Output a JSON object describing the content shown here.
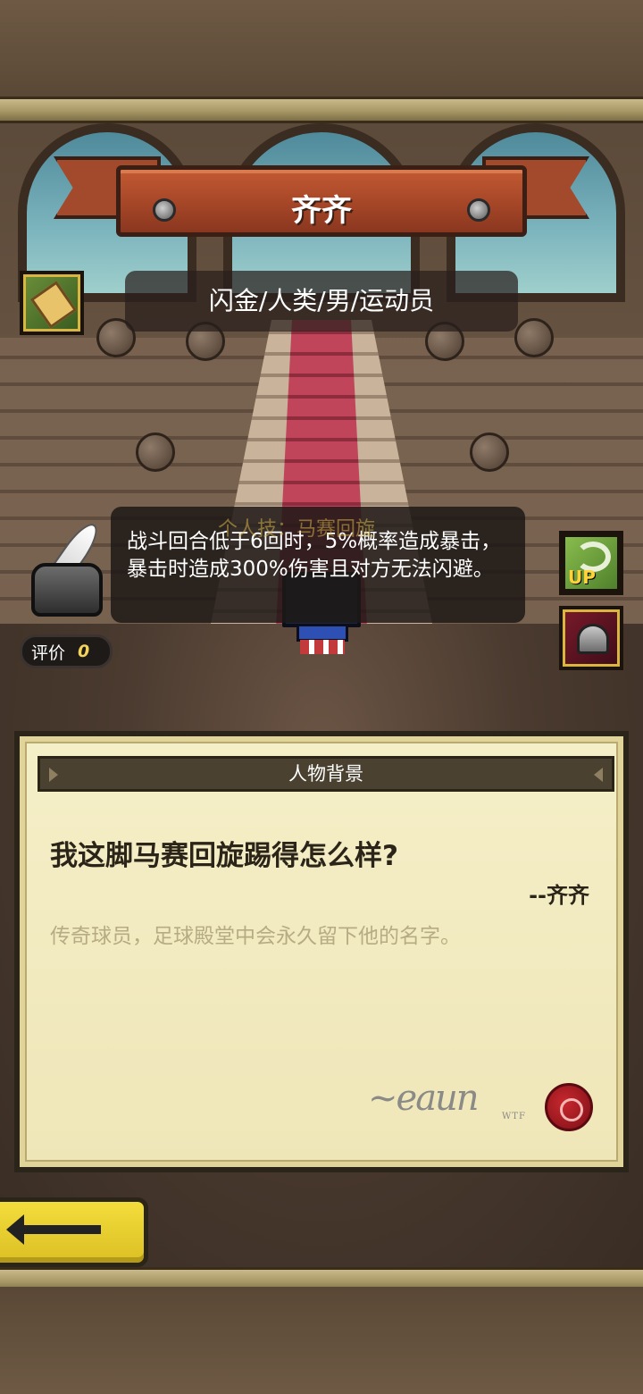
{
  "hero": {
    "name": "齐齐",
    "tags": "闪金/人类/男/运动员"
  },
  "skill": {
    "title_partial": "个人技：马赛回旋",
    "description": "战斗回合低于6回时，5%概率造成暴击，暴击时造成300%伤害且对方无法闪避。"
  },
  "rating": {
    "label": "评价",
    "value": "0"
  },
  "badges": {
    "up_label": "UP"
  },
  "background": {
    "header": "人物背景",
    "quote": "我这脚马赛回旋踢得怎么样?",
    "author": "--齐齐",
    "description": "传奇球员，足球殿堂中会永久留下他的名字。",
    "signature_mark": "WTF"
  },
  "icons": {
    "scroll": "scroll-icon",
    "inkwell": "inkwell-icon",
    "tornado": "tornado-icon",
    "helmet": "helmet-icon",
    "back": "back-arrow-icon",
    "seal": "wax-seal-icon"
  },
  "colors": {
    "banner": "#a24426",
    "panel": "#f5efc8",
    "back_button": "#f3dd3b",
    "rating_value": "#f3d35a"
  }
}
